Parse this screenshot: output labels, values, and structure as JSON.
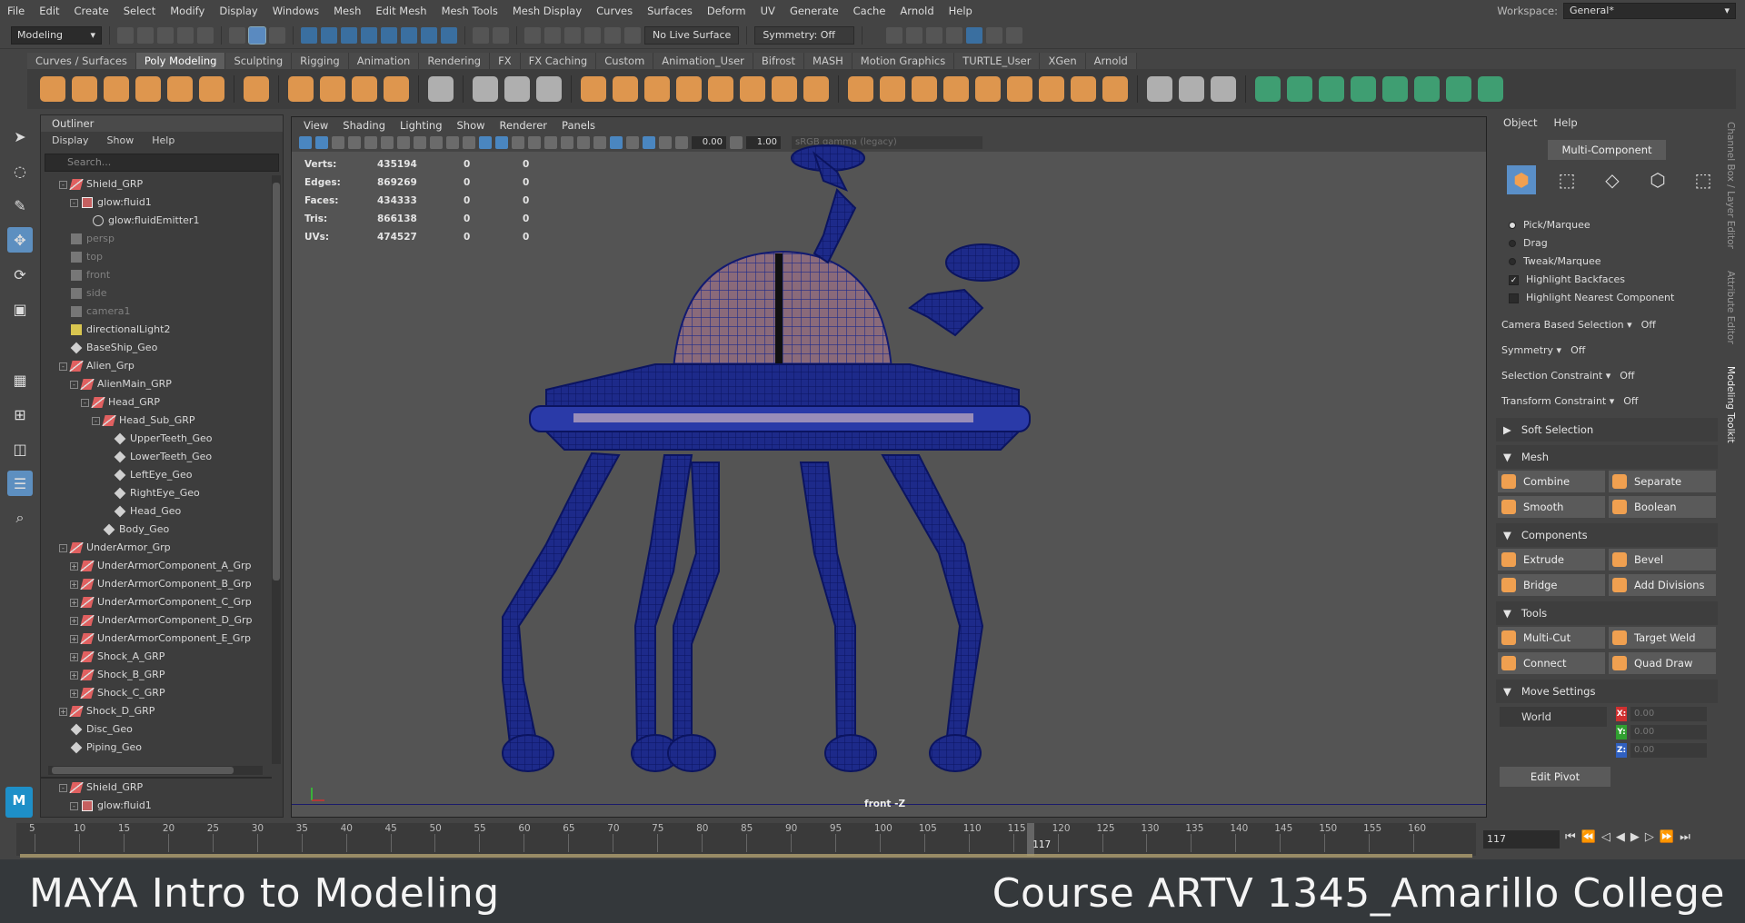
{
  "menubar": {
    "items": [
      "File",
      "Edit",
      "Create",
      "Select",
      "Modify",
      "Display",
      "Windows",
      "Mesh",
      "Edit Mesh",
      "Mesh Tools",
      "Mesh Display",
      "Curves",
      "Surfaces",
      "Deform",
      "UV",
      "Generate",
      "Cache",
      "Arnold",
      "Help"
    ],
    "workspace_label": "Workspace:",
    "workspace_value": "General*"
  },
  "statusline": {
    "mode": "Modeling",
    "live_surface": "No Live Surface",
    "symmetry": "Symmetry: Off"
  },
  "shelf": {
    "tabs": [
      "Curves / Surfaces",
      "Poly Modeling",
      "Sculpting",
      "Rigging",
      "Animation",
      "Rendering",
      "FX",
      "FX Caching",
      "Custom",
      "Animation_User",
      "Bifrost",
      "MASH",
      "Motion Graphics",
      "TURTLE_User",
      "XGen",
      "Arnold"
    ],
    "active_tab": "Poly Modeling"
  },
  "outliner": {
    "title": "Outliner",
    "menu": [
      "Display",
      "Show",
      "Help"
    ],
    "search_placeholder": "Search...",
    "rows": [
      {
        "label": "Shield_GRP",
        "indent": 1,
        "icon": "grp",
        "expand": "-"
      },
      {
        "label": "glow:fluid1",
        "indent": 2,
        "icon": "fluid",
        "expand": "-"
      },
      {
        "label": "glow:fluidEmitter1",
        "indent": 3,
        "icon": "emit",
        "expand": ""
      },
      {
        "label": "persp",
        "indent": 1,
        "icon": "cam",
        "dim": true
      },
      {
        "label": "top",
        "indent": 1,
        "icon": "cam",
        "dim": true
      },
      {
        "label": "front",
        "indent": 1,
        "icon": "cam",
        "dim": true
      },
      {
        "label": "side",
        "indent": 1,
        "icon": "cam",
        "dim": true
      },
      {
        "label": "camera1",
        "indent": 1,
        "icon": "cam",
        "dim": true
      },
      {
        "label": "directionalLight2",
        "indent": 1,
        "icon": "light"
      },
      {
        "label": "BaseShip_Geo",
        "indent": 1,
        "icon": "geo"
      },
      {
        "label": "Alien_Grp",
        "indent": 1,
        "icon": "grp",
        "expand": "-"
      },
      {
        "label": "AlienMain_GRP",
        "indent": 2,
        "icon": "grp",
        "expand": "-"
      },
      {
        "label": "Head_GRP",
        "indent": 3,
        "icon": "grp",
        "expand": "-"
      },
      {
        "label": "Head_Sub_GRP",
        "indent": 4,
        "icon": "grp",
        "expand": "-"
      },
      {
        "label": "UpperTeeth_Geo",
        "indent": 5,
        "icon": "geo"
      },
      {
        "label": "LowerTeeth_Geo",
        "indent": 5,
        "icon": "geo"
      },
      {
        "label": "LeftEye_Geo",
        "indent": 5,
        "icon": "geo"
      },
      {
        "label": "RightEye_Geo",
        "indent": 5,
        "icon": "geo"
      },
      {
        "label": "Head_Geo",
        "indent": 5,
        "icon": "geo"
      },
      {
        "label": "Body_Geo",
        "indent": 4,
        "icon": "geo"
      },
      {
        "label": "UnderArmor_Grp",
        "indent": 1,
        "icon": "grp",
        "expand": "-"
      },
      {
        "label": "UnderArmorComponent_A_Grp",
        "indent": 2,
        "icon": "grp",
        "expand": "+"
      },
      {
        "label": "UnderArmorComponent_B_Grp",
        "indent": 2,
        "icon": "grp",
        "expand": "+"
      },
      {
        "label": "UnderArmorComponent_C_Grp",
        "indent": 2,
        "icon": "grp",
        "expand": "+"
      },
      {
        "label": "UnderArmorComponent_D_Grp",
        "indent": 2,
        "icon": "grp",
        "expand": "+"
      },
      {
        "label": "UnderArmorComponent_E_Grp",
        "indent": 2,
        "icon": "grp",
        "expand": "+"
      },
      {
        "label": "Shock_A_GRP",
        "indent": 2,
        "icon": "grp",
        "expand": "+"
      },
      {
        "label": "Shock_B_GRP",
        "indent": 2,
        "icon": "grp",
        "expand": "+"
      },
      {
        "label": "Shock_C_GRP",
        "indent": 2,
        "icon": "grp",
        "expand": "+"
      },
      {
        "label": "Shock_D_GRP",
        "indent": 1,
        "icon": "grp",
        "expand": "+"
      },
      {
        "label": "Disc_Geo",
        "indent": 1,
        "icon": "geo"
      },
      {
        "label": "Piping_Geo",
        "indent": 1,
        "icon": "geo"
      }
    ],
    "bottom_rows": [
      {
        "label": "Shield_GRP",
        "indent": 1,
        "icon": "grp",
        "expand": "-"
      },
      {
        "label": "glow:fluid1",
        "indent": 2,
        "icon": "fluid",
        "expand": "-"
      }
    ]
  },
  "viewport": {
    "menu": [
      "View",
      "Shading",
      "Lighting",
      "Show",
      "Renderer",
      "Panels"
    ],
    "exposure": "0.00",
    "gamma": "1.00",
    "color_space": "sRGB gamma (legacy)",
    "hud": [
      {
        "label": "Verts:",
        "v1": "435194",
        "v2": "0",
        "v3": "0"
      },
      {
        "label": "Edges:",
        "v1": "869269",
        "v2": "0",
        "v3": "0"
      },
      {
        "label": "Faces:",
        "v1": "434333",
        "v2": "0",
        "v3": "0"
      },
      {
        "label": "Tris:",
        "v1": "866138",
        "v2": "0",
        "v3": "0"
      },
      {
        "label": "UVs:",
        "v1": "474527",
        "v2": "0",
        "v3": "0"
      }
    ],
    "camera_label": "front -Z"
  },
  "modeling_toolkit": {
    "menu": [
      "Object",
      "Help"
    ],
    "multi_component": "Multi-Component",
    "selection_modes": [
      {
        "label": "Pick/Marquee",
        "type": "radio",
        "on": true
      },
      {
        "label": "Drag",
        "type": "radio",
        "on": false
      },
      {
        "label": "Tweak/Marquee",
        "type": "radio",
        "on": false
      },
      {
        "label": "Highlight Backfaces",
        "type": "check",
        "on": true
      },
      {
        "label": "Highlight Nearest Component",
        "type": "check",
        "on": false
      }
    ],
    "options": [
      {
        "label": "Camera Based Selection",
        "value": "Off"
      },
      {
        "label": "Symmetry",
        "value": "Off"
      },
      {
        "label": "Selection Constraint",
        "value": "Off"
      },
      {
        "label": "Transform Constraint",
        "value": "Off"
      }
    ],
    "soft_selection": "Soft Selection",
    "mesh_header": "Mesh",
    "mesh_buttons": [
      "Combine",
      "Separate",
      "Smooth",
      "Boolean"
    ],
    "components_header": "Components",
    "component_buttons": [
      "Extrude",
      "Bevel",
      "Bridge",
      "Add Divisions"
    ],
    "tools_header": "Tools",
    "tool_buttons": [
      "Multi-Cut",
      "Target Weld",
      "Connect",
      "Quad Draw"
    ],
    "move_settings_header": "Move Settings",
    "world": "World",
    "x": "0.00",
    "y": "0.00",
    "z": "0.00",
    "edit_pivot": "Edit Pivot",
    "side_tabs": [
      "Channel Box / Layer Editor",
      "Attribute Editor",
      "Modeling Toolkit"
    ]
  },
  "timeline": {
    "ticks": [
      "5",
      "10",
      "15",
      "20",
      "25",
      "30",
      "35",
      "40",
      "45",
      "50",
      "55",
      "60",
      "65",
      "70",
      "75",
      "80",
      "85",
      "90",
      "95",
      "100",
      "105",
      "110",
      "115",
      "120",
      "125",
      "130",
      "135",
      "140",
      "145",
      "150",
      "155",
      "160"
    ],
    "current_frame": "117",
    "frame_field": "117"
  },
  "caption": {
    "left": "MAYA Intro to Modeling",
    "right": "Course ARTV 1345_Amarillo  College"
  }
}
